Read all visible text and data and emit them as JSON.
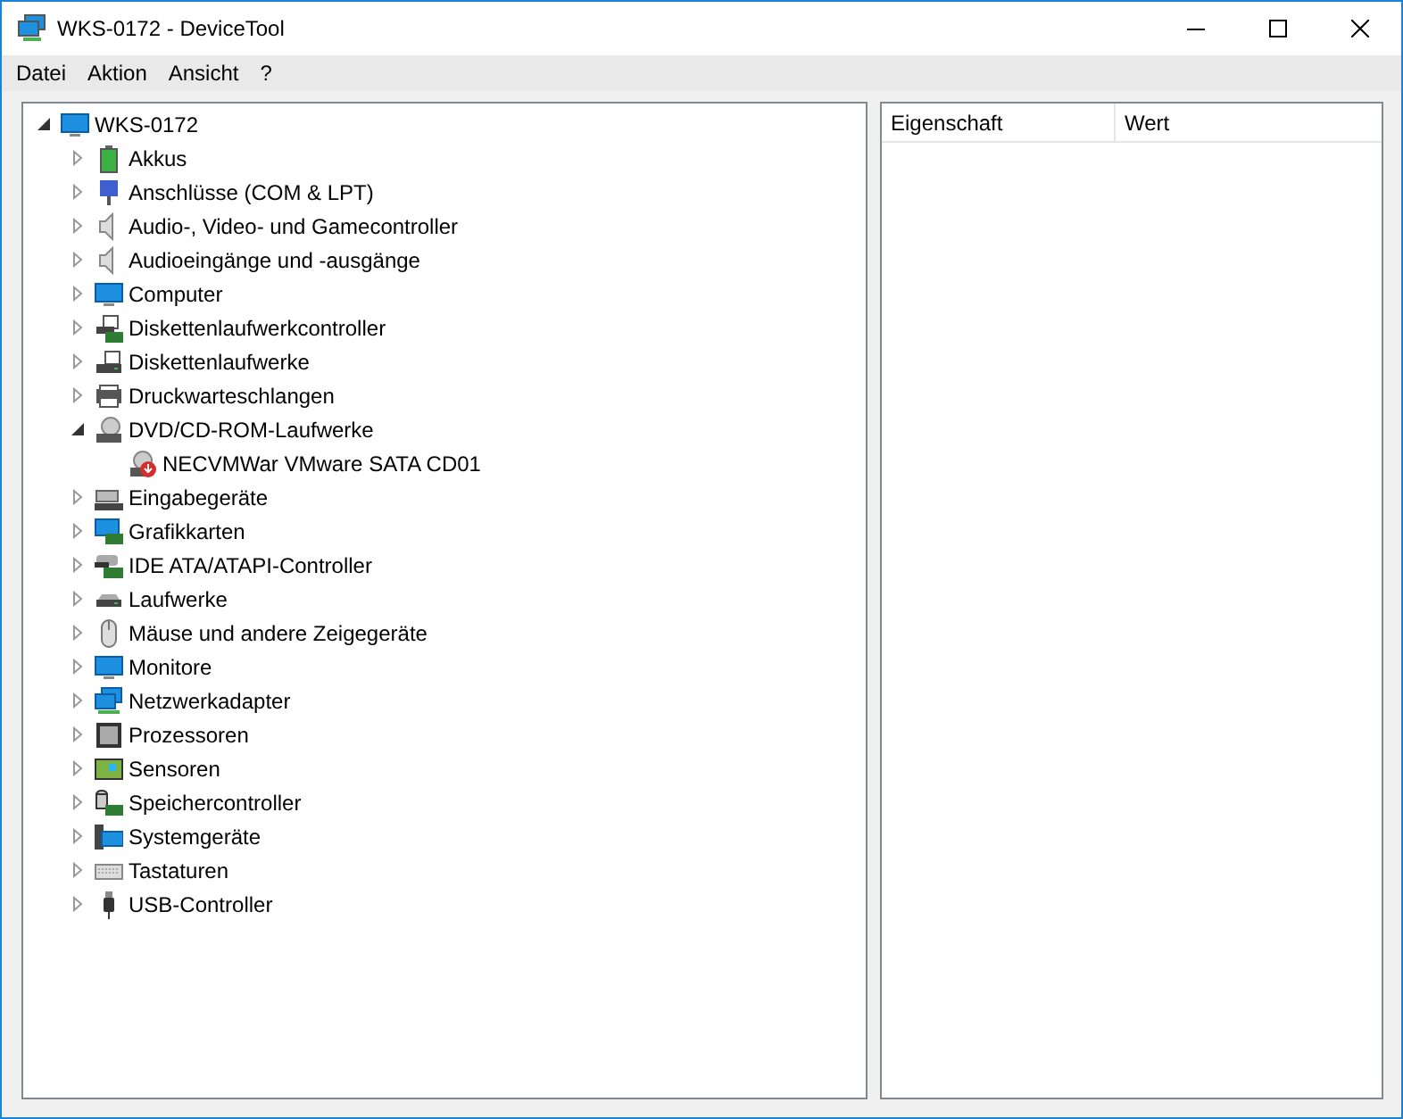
{
  "window": {
    "title": "WKS-0172 - DeviceTool"
  },
  "menu": [
    "Datei",
    "Aktion",
    "Ansicht",
    "?"
  ],
  "tree": [
    {
      "label": "WKS-0172",
      "kind": "monitor",
      "expanded": true,
      "children": [
        {
          "label": "Akkus",
          "kind": "battery",
          "expanded": false
        },
        {
          "label": "Anschlüsse (COM & LPT)",
          "kind": "port",
          "expanded": false
        },
        {
          "label": "Audio-, Video- und Gamecontroller",
          "kind": "speaker",
          "expanded": false
        },
        {
          "label": "Audioeingänge und -ausgänge",
          "kind": "speaker",
          "expanded": false
        },
        {
          "label": "Computer",
          "kind": "monitor",
          "expanded": false
        },
        {
          "label": "Diskettenlaufwerkcontroller",
          "kind": "floppyctrl",
          "expanded": false
        },
        {
          "label": "Diskettenlaufwerke",
          "kind": "floppy",
          "expanded": false
        },
        {
          "label": "Druckwarteschlangen",
          "kind": "printer",
          "expanded": false
        },
        {
          "label": "DVD/CD-ROM-Laufwerke",
          "kind": "disc",
          "expanded": true,
          "children": [
            {
              "label": "NECVMWar VMware SATA CD01",
              "kind": "discdevice"
            }
          ]
        },
        {
          "label": "Eingabegeräte",
          "kind": "keyboardctrl",
          "expanded": false
        },
        {
          "label": "Grafikkarten",
          "kind": "display",
          "expanded": false
        },
        {
          "label": "IDE ATA/ATAPI-Controller",
          "kind": "ide",
          "expanded": false
        },
        {
          "label": "Laufwerke",
          "kind": "drive",
          "expanded": false
        },
        {
          "label": "Mäuse und andere Zeigegeräte",
          "kind": "mouse",
          "expanded": false
        },
        {
          "label": "Monitore",
          "kind": "monitor",
          "expanded": false
        },
        {
          "label": "Netzwerkadapter",
          "kind": "network",
          "expanded": false
        },
        {
          "label": "Prozessoren",
          "kind": "cpu",
          "expanded": false
        },
        {
          "label": "Sensoren",
          "kind": "sensor",
          "expanded": false
        },
        {
          "label": "Speichercontroller",
          "kind": "storage",
          "expanded": false
        },
        {
          "label": "Systemgeräte",
          "kind": "system",
          "expanded": false
        },
        {
          "label": "Tastaturen",
          "kind": "keyboard",
          "expanded": false
        },
        {
          "label": "USB-Controller",
          "kind": "usb",
          "expanded": false
        }
      ]
    }
  ],
  "properties": {
    "columns": [
      "Eigenschaft",
      "Wert"
    ]
  }
}
